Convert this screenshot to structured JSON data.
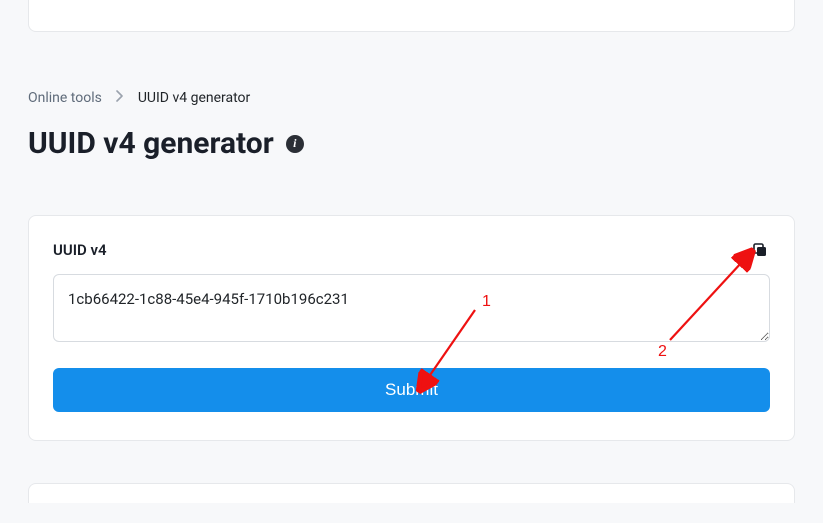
{
  "breadcrumb": {
    "root": "Online tools",
    "current": "UUID v4 generator"
  },
  "page": {
    "title": "UUID v4 generator"
  },
  "form": {
    "field_label": "UUID v4",
    "uuid_value": "1cb66422-1c88-45e4-945f-1710b196c231",
    "submit_label": "Submit"
  },
  "annotations": {
    "label1": "1",
    "label2": "2"
  }
}
